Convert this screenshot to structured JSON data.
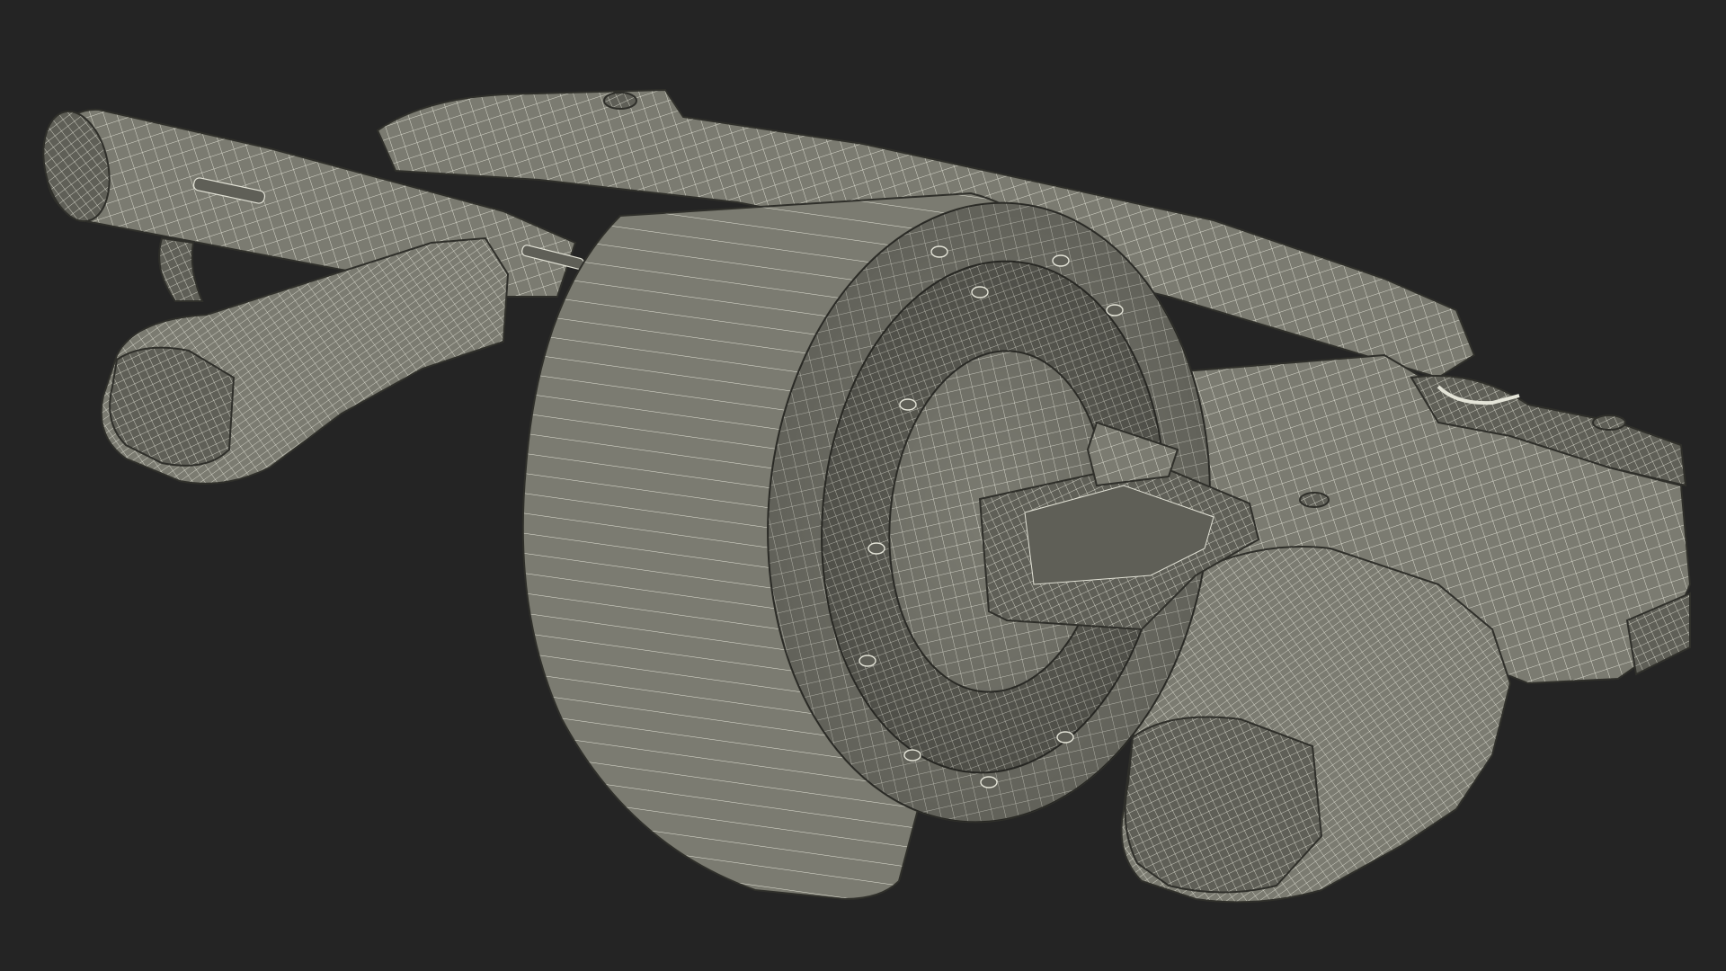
{
  "scene": {
    "subject": "revolver-grenade-launcher-wireframe",
    "background_color": "#242424",
    "body_color": "#7b7b71",
    "body_shadow_color": "#5f5f57",
    "body_highlight_color": "#8c8c82",
    "wire_color": "#e4e4d8",
    "outline_color": "#2f2f2a"
  }
}
